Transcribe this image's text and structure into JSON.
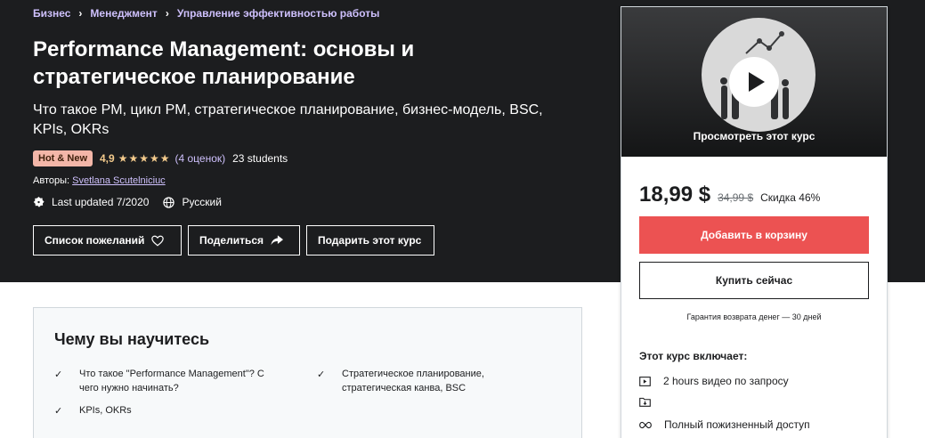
{
  "breadcrumb": [
    "Бизнес",
    "Менеджмент",
    "Управление эффективностью работы"
  ],
  "course": {
    "title": "Performance Management: основы и стратегическое планирование",
    "subtitle": "Что такое PM, цикл PM, стратегическое планирование, бизнес-модель, BSC, KPIs, OKRs",
    "badge": "Hot & New",
    "rating": "4,9",
    "stars": "★★★★★",
    "rating_count": "(4 оценок)",
    "students": "23 students",
    "authors_label": "Авторы:",
    "author": "Svetlana Scutelniciuc",
    "last_updated": "Last updated 7/2020",
    "language": "Русский"
  },
  "actions": {
    "wishlist": "Список пожеланий",
    "share": "Поделиться",
    "gift": "Подарить этот курс"
  },
  "sidebar": {
    "preview_label": "Просмотреть этот курс",
    "price": "18,99 $",
    "old_price": "34,99 $",
    "discount": "Скидка 46%",
    "add_to_cart": "Добавить в корзину",
    "buy_now": "Купить сейчас",
    "guarantee": "Гарантия возврата денег — 30 дней",
    "includes_title": "Этот курс включает:",
    "includes": [
      "2 hours видео по запросу",
      "",
      "Полный пожизненный доступ"
    ]
  },
  "learn": {
    "title": "Чему вы научитесь",
    "items": [
      "Что такое \"Performance Management\"? С чего нужно начинать?",
      "Стратегическое планирование, стратегическая канва, BSC",
      "KPIs, OKRs"
    ]
  },
  "colors": {
    "hero_bg": "#1c1d1f",
    "link": "#cec0fc",
    "star": "#f3ca8c",
    "badge_hot": "#f3b6a8",
    "cart_button": "#ec5252"
  }
}
